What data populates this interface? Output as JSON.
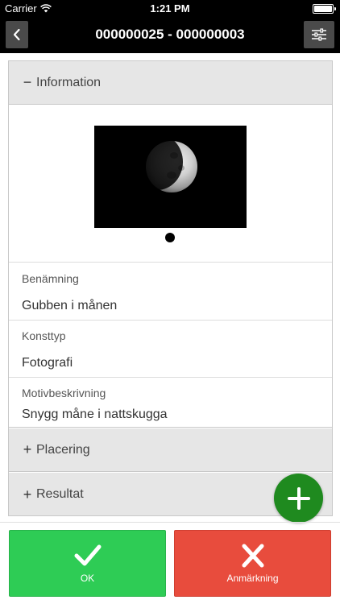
{
  "status_bar": {
    "carrier": "Carrier",
    "time": "1:21 PM",
    "battery_level_percent": 100
  },
  "nav": {
    "title": "000000025 - 000000003",
    "back_icon": "chevron-left-icon",
    "settings_icon": "sliders-icon"
  },
  "sections": {
    "information": {
      "sign": "−",
      "label": "Information"
    },
    "placering": {
      "sign": "+",
      "label": "Placering"
    },
    "resultat": {
      "sign": "+",
      "label": "Resultat"
    }
  },
  "fields": [
    {
      "label": "Benämning",
      "value": "Gubben i månen"
    },
    {
      "label": "Konsttyp",
      "value": "Fotografi"
    },
    {
      "label": "Motivbeskrivning",
      "value": "Snygg måne i nattskugga"
    }
  ],
  "buttons": {
    "ok_label": "OK",
    "remark_label": "Anmärkning"
  },
  "colors": {
    "ok": "#2ecc55",
    "remark": "#e84c3d",
    "fab": "#1f8a1f"
  }
}
